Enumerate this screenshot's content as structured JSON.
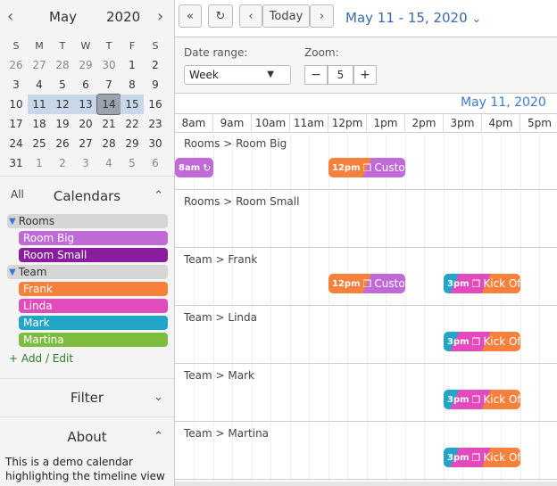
{
  "mini_calendar": {
    "month": "May",
    "year": "2020",
    "prev_icon": "chevron-left-icon",
    "next_icon": "chevron-right-icon",
    "weekdays": [
      "S",
      "M",
      "T",
      "W",
      "T",
      "F",
      "S"
    ],
    "weeks": [
      [
        "26",
        "27",
        "28",
        "29",
        "30",
        "1",
        "2"
      ],
      [
        "3",
        "4",
        "5",
        "6",
        "7",
        "8",
        "9"
      ],
      [
        "10",
        "11",
        "12",
        "13",
        "14",
        "15",
        "16"
      ],
      [
        "17",
        "18",
        "19",
        "20",
        "21",
        "22",
        "23"
      ],
      [
        "24",
        "25",
        "26",
        "27",
        "28",
        "29",
        "30"
      ],
      [
        "31",
        "1",
        "2",
        "3",
        "4",
        "5",
        "6"
      ]
    ]
  },
  "calendars": {
    "all_label": "All",
    "title": "Calendars",
    "groups": [
      {
        "name": "Rooms",
        "items": [
          {
            "label": "Room Big",
            "color": "#c06ad8"
          },
          {
            "label": "Room Small",
            "color": "#8a1c9e"
          }
        ]
      },
      {
        "name": "Team",
        "items": [
          {
            "label": "Frank",
            "color": "#f5813d"
          },
          {
            "label": "Linda",
            "color": "#e14bbc"
          },
          {
            "label": "Mark",
            "color": "#21a5c9"
          },
          {
            "label": "Martina",
            "color": "#7cbc3f"
          }
        ]
      }
    ],
    "add_edit": "Add / Edit"
  },
  "filter": {
    "title": "Filter"
  },
  "about": {
    "title": "About",
    "text": "This is a demo calendar highlighting the timeline view"
  },
  "toolbar": {
    "today": "Today",
    "range_title": "May 11 - 15, 2020"
  },
  "controls": {
    "date_range_label": "Date range:",
    "date_range_value": "Week",
    "zoom_label": "Zoom:",
    "zoom_value": "5",
    "minus": "−",
    "plus": "+"
  },
  "timeline": {
    "date": "May 11, 2020",
    "hours": [
      "8am",
      "9am",
      "10am",
      "11am",
      "12pm",
      "1pm",
      "2pm",
      "3pm",
      "4pm",
      "5pm"
    ],
    "rows": [
      {
        "label": "Rooms > Room Big"
      },
      {
        "label": "Rooms > Room Small"
      },
      {
        "label": "Team > Frank"
      },
      {
        "label": "Team > Linda"
      },
      {
        "label": "Team > Mark"
      },
      {
        "label": "Team > Martina"
      }
    ],
    "events": {
      "e1": {
        "time": "8am",
        "title": "",
        "colors": [
          "#c06ad8"
        ]
      },
      "e2": {
        "time": "12pm",
        "title": "Custom",
        "colors": [
          "#f5813d",
          "#c06ad8"
        ]
      },
      "e3": {
        "time": "12pm",
        "title": "Custom",
        "colors": [
          "#f5813d",
          "#c06ad8"
        ]
      },
      "e4": {
        "time": "3pm",
        "title": "Kick Off",
        "colors": [
          "#21a5c9",
          "#e14bbc",
          "#f5813d"
        ]
      },
      "e5": {
        "time": "3pm",
        "title": "Kick Off",
        "colors": [
          "#21a5c9",
          "#e14bbc",
          "#f5813d"
        ]
      },
      "e6": {
        "time": "3pm",
        "title": "Kick Off",
        "colors": [
          "#21a5c9",
          "#e14bbc",
          "#f5813d"
        ]
      },
      "e7": {
        "time": "3pm",
        "title": "Kick Off",
        "colors": [
          "#21a5c9",
          "#e14bbc",
          "#f5813d"
        ]
      }
    }
  }
}
